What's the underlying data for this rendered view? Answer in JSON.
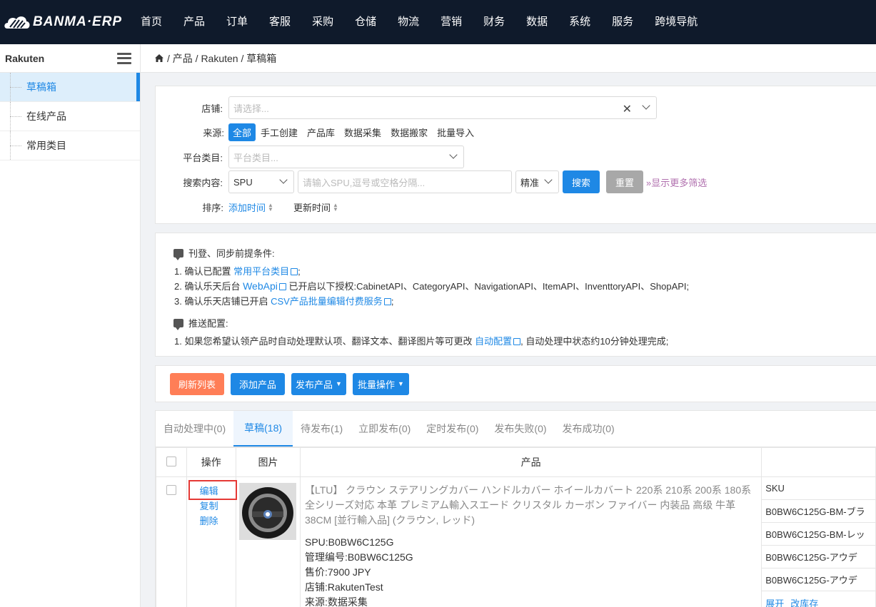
{
  "brand": {
    "name": "BANMA·ERP"
  },
  "nav": [
    "首页",
    "产品",
    "订单",
    "客服",
    "采购",
    "仓储",
    "物流",
    "营销",
    "财务",
    "数据",
    "系统",
    "服务",
    "跨境导航"
  ],
  "sidebar": {
    "title": "Rakuten",
    "items": [
      {
        "label": "草稿箱",
        "active": true
      },
      {
        "label": "在线产品",
        "active": false
      },
      {
        "label": "常用类目",
        "active": false
      }
    ]
  },
  "breadcrumb": "/ 产品 / Rakuten / 草稿箱",
  "filter": {
    "store_label": "店铺:",
    "store_placeholder": "请选择...",
    "source_label": "来源:",
    "sources": [
      "全部",
      "手工创建",
      "产品库",
      "数据采集",
      "数据搬家",
      "批量导入"
    ],
    "category_label": "平台类目:",
    "category_placeholder": "平台类目...",
    "search_label": "搜索内容:",
    "search_field": "SPU",
    "search_placeholder": "请输入SPU,逗号或空格分隔...",
    "match_mode": "精准",
    "search_button": "搜索",
    "reset_button": "重置",
    "more_filters": "显示更多筛选",
    "sort_label": "排序:",
    "sort_options": [
      "添加时间",
      "更新时间"
    ]
  },
  "notice": {
    "heading1": "刊登、同步前提条件:",
    "line1_prefix": "1. 确认已配置 ",
    "line1_link": "常用平台类目",
    "line1_suffix": ";",
    "line2_prefix": "2. 确认乐天后台 ",
    "line2_link": "WebApi",
    "line2_suffix": " 已开启以下授权:CabinetAPI、CategoryAPI、NavigationAPI、ItemAPI、InventtoryAPI、ShopAPI;",
    "line3_prefix": "3. 确认乐天店铺已开启 ",
    "line3_link": "CSV产品批量编辑付费服务",
    "line3_suffix": ";",
    "heading2": "推送配置:",
    "line4_prefix": "1. 如果您希望认领产品时自动处理默认项、翻译文本、翻译图片等可更改 ",
    "line4_link": "自动配置",
    "line4_suffix": ", 自动处理中状态约10分钟处理完成;"
  },
  "actions": {
    "refresh": "刷新列表",
    "add": "添加产品",
    "publish": "发布产品",
    "batch": "批量操作"
  },
  "tabs": [
    {
      "label": "自动处理中(0)",
      "active": false
    },
    {
      "label": "草稿(18)",
      "active": true
    },
    {
      "label": "待发布(1)",
      "active": false
    },
    {
      "label": "立即发布(0)",
      "active": false
    },
    {
      "label": "定时发布(0)",
      "active": false
    },
    {
      "label": "发布失败(0)",
      "active": false
    },
    {
      "label": "发布成功(0)",
      "active": false
    }
  ],
  "table": {
    "headers": {
      "op": "操作",
      "image": "图片",
      "product": "产品"
    },
    "row": {
      "ops": [
        "编辑",
        "复制",
        "删除"
      ],
      "title": "【LTU】 クラウン ステアリングカバー ハンドルカバー ホイールカバート 220系 210系 200系 180系 全シリーズ対応 本革 プレミアム輸入スエード クリスタル カーボン ファイバー 内装品 高级 牛革 38CM [並行輸入品] (クラウン, レッド)",
      "meta": [
        "SPU:B0BW6C125G",
        "管理编号:B0BW6C125G",
        "售价:7900 JPY",
        "店铺:RakutenTest",
        "来源:数据采集"
      ],
      "sku_header": "SKU",
      "skus": [
        "B0BW6C125G-BM-ブラ",
        "B0BW6C125G-BM-レッ",
        "B0BW6C125G-アウデ",
        "B0BW6C125G-アウデ"
      ],
      "sku_links": [
        "展开",
        "改库存"
      ]
    }
  }
}
